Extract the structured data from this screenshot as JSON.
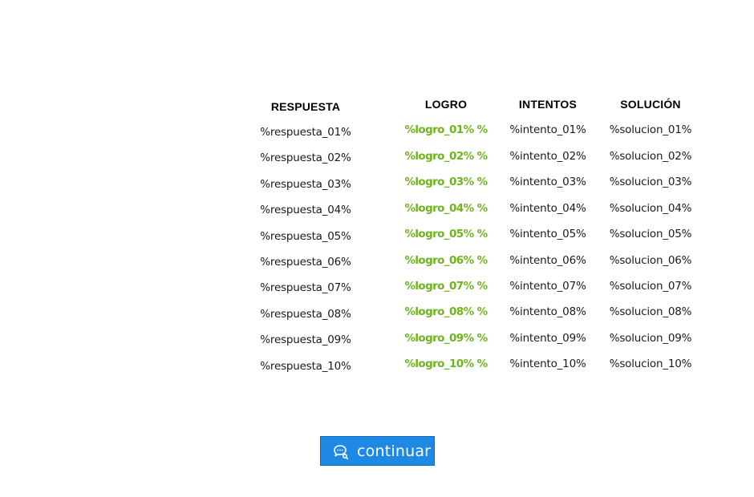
{
  "table": {
    "headers": [
      "RESPUESTA",
      "LOGRO",
      "INTENTOS",
      "SOLUCIÓN"
    ],
    "rows": [
      {
        "respuesta": "%respuesta_01%",
        "logro": "%logro_01% %",
        "intento": "%intento_01%",
        "solucion": "%solucion_01%"
      },
      {
        "respuesta": "%respuesta_02%",
        "logro": "%logro_02% %",
        "intento": "%intento_02%",
        "solucion": "%solucion_02%"
      },
      {
        "respuesta": "%respuesta_03%",
        "logro": "%logro_03% %",
        "intento": "%intento_03%",
        "solucion": "%solucion_03%"
      },
      {
        "respuesta": "%respuesta_04%",
        "logro": "%logro_04% %",
        "intento": "%intento_04%",
        "solucion": "%solucion_04%"
      },
      {
        "respuesta": "%respuesta_05%",
        "logro": "%logro_05% %",
        "intento": "%intento_05%",
        "solucion": "%solucion_05%"
      },
      {
        "respuesta": "%respuesta_06%",
        "logro": "%logro_06% %",
        "intento": "%intento_06%",
        "solucion": "%solucion_06%"
      },
      {
        "respuesta": "%respuesta_07%",
        "logro": "%logro_07% %",
        "intento": "%intento_07%",
        "solucion": "%solucion_07%"
      },
      {
        "respuesta": "%respuesta_08%",
        "logro": "%logro_08% %",
        "intento": "%intento_08%",
        "solucion": "%solucion_08%"
      },
      {
        "respuesta": "%respuesta_09%",
        "logro": "%logro_09% %",
        "intento": "%intento_09%",
        "solucion": "%solucion_09%"
      },
      {
        "respuesta": "%respuesta_10%",
        "logro": "%logro_10% %",
        "intento": "%intento_10%",
        "solucion": "%solucion_10%"
      }
    ]
  },
  "button": {
    "label": "continuar",
    "icon": "chat-bubble-icon"
  },
  "colors": {
    "logro": "#6fb31f",
    "button_bg": "#1e88e5"
  }
}
